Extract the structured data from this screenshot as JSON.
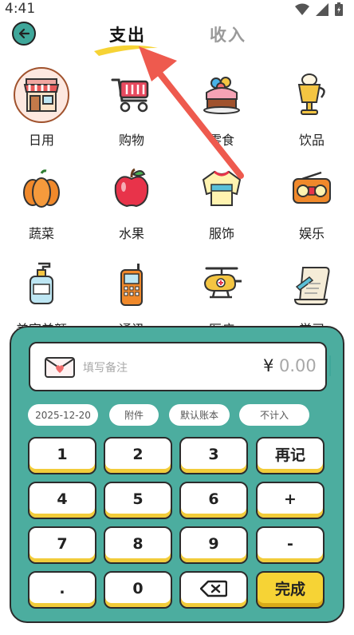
{
  "status_bar": {
    "time": "4:41",
    "icons": [
      "wifi-icon",
      "signal-icon",
      "battery-icon"
    ]
  },
  "header": {
    "tab_expense": "支出",
    "tab_income": "收入"
  },
  "categories": [
    {
      "label": "日用",
      "icon": "shop-icon",
      "selected": true
    },
    {
      "label": "购物",
      "icon": "shopping-cart-icon"
    },
    {
      "label": "零食",
      "icon": "cake-icon"
    },
    {
      "label": "饮品",
      "icon": "drink-icon"
    },
    {
      "label": "蔬菜",
      "icon": "pumpkin-icon"
    },
    {
      "label": "水果",
      "icon": "apple-icon"
    },
    {
      "label": "服饰",
      "icon": "sweater-icon"
    },
    {
      "label": "娱乐",
      "icon": "radio-icon"
    },
    {
      "label": "美容美颜",
      "icon": "lotion-icon"
    },
    {
      "label": "通讯",
      "icon": "phone-icon"
    },
    {
      "label": "医疗",
      "icon": "helicopter-icon"
    },
    {
      "label": "学习",
      "icon": "scroll-icon"
    }
  ],
  "input": {
    "memo_placeholder": "填写备注",
    "currency": "¥",
    "amount": "0.00"
  },
  "chips": {
    "date": "2025-12-20",
    "attachment": "附件",
    "account": "默认账本",
    "exclude": "不计入"
  },
  "keys": {
    "k1": "1",
    "k2": "2",
    "k3": "3",
    "again": "再记",
    "k4": "4",
    "k5": "5",
    "k6": "6",
    "plus": "+",
    "k7": "7",
    "k8": "8",
    "k9": "9",
    "minus": "-",
    "dot": ".",
    "k0": "0",
    "done": "完成"
  },
  "colors": {
    "teal": "#4cad9f",
    "yellow": "#f6d335",
    "annotation_red": "#ee5a4e"
  }
}
